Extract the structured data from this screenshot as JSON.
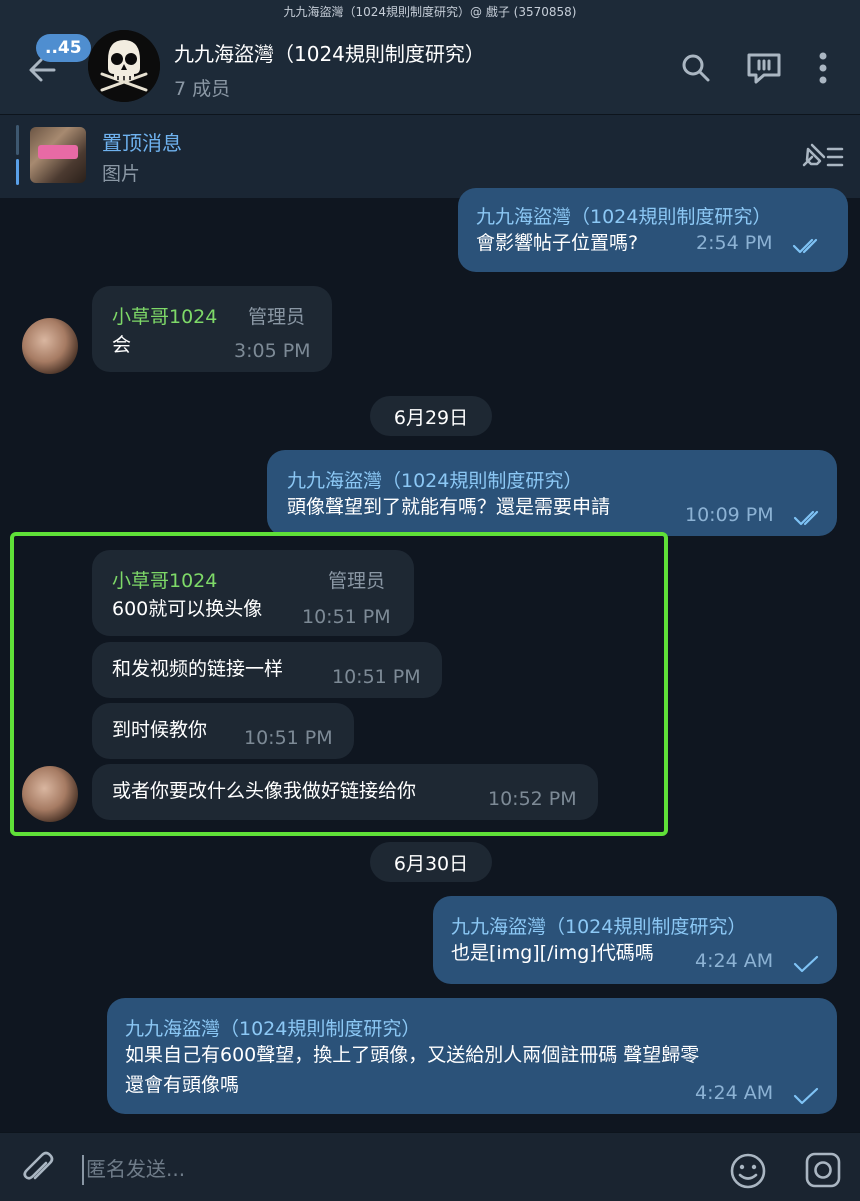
{
  "status_strip": {
    "text": "九九海盜灣（1024規則制度研究）@ 戲子 (3570858)"
  },
  "header": {
    "back_badge": "..45",
    "title": "九九海盜灣（1024規則制度研究）",
    "members": "7 成员",
    "icons": [
      "back-arrow-icon",
      "search-icon",
      "chat-bubbles-icon",
      "more-vert-icon"
    ]
  },
  "pinned": {
    "title": "置顶消息",
    "subtitle": "图片",
    "icon": "pin-list-icon"
  },
  "chat": {
    "messages": [
      {
        "sender": "九九海盜灣（1024規則制度研究）",
        "text": "會影響帖子位置嗎?",
        "time": "2:54 PM",
        "direction": "out",
        "status": "read"
      },
      {
        "sender": "小草哥1024",
        "role": "管理员",
        "text": "会",
        "time": "3:05 PM",
        "direction": "in"
      },
      {
        "date": "6月29日"
      },
      {
        "sender": "九九海盜灣（1024規則制度研究）",
        "text": "頭像聲望到了就能有嗎？還是需要申請",
        "time": "10:09 PM",
        "direction": "out",
        "status": "read"
      },
      {
        "sender": "小草哥1024",
        "role": "管理员",
        "text": "600就可以换头像",
        "time": "10:51 PM",
        "direction": "in"
      },
      {
        "text": "和发视频的链接一样",
        "time": "10:51 PM",
        "direction": "in"
      },
      {
        "text": "到时候教你",
        "time": "10:51 PM",
        "direction": "in"
      },
      {
        "text": "或者你要改什么头像我做好链接给你",
        "time": "10:52 PM",
        "direction": "in"
      },
      {
        "date": "6月30日"
      },
      {
        "sender": "九九海盜灣（1024規則制度研究）",
        "text": "也是[img][/img]代碼嗎",
        "time": "4:24 AM",
        "direction": "out",
        "status": "sent"
      },
      {
        "sender": "九九海盜灣（1024規則制度研究）",
        "text_line1": "如果自己有600聲望，換上了頭像，又送給別人兩個註冊碼 聲望歸零",
        "text_line2": "還會有頭像嗎",
        "time": "4:24 AM",
        "direction": "out",
        "status": "sent"
      }
    ]
  },
  "input": {
    "placeholder": "匿名发送...",
    "icons": [
      "attach-icon",
      "emoji-icon",
      "camera-icon"
    ]
  },
  "colors": {
    "background": "#0f1620",
    "header": "#1d2a38",
    "outgoing_bubble": "#2b5279",
    "incoming_bubble": "#1e2833",
    "link_blue": "#6fb2ef",
    "admin_name_green": "#7ed968",
    "highlight_green": "#5fe038",
    "badge_blue": "#4f8ed0"
  }
}
